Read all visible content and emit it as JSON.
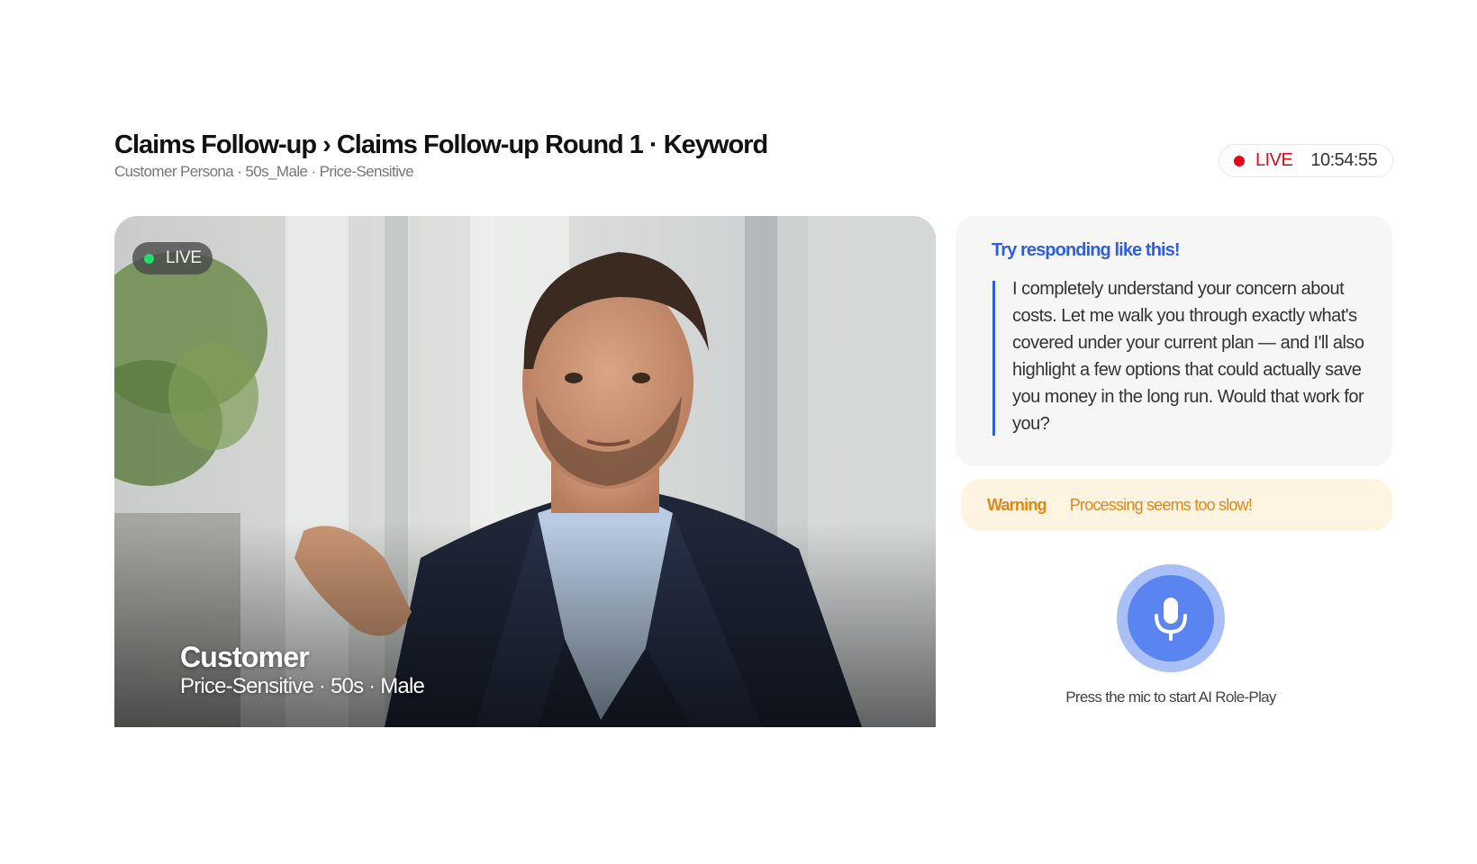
{
  "header": {
    "title": "Claims Follow-up › Claims Follow-up Round 1 · Keyword",
    "subtitle": "Customer Persona · 50s_Male · Price-Sensitive"
  },
  "status": {
    "live_label": "LIVE",
    "time": "10:54:55",
    "live_color": "#e30613"
  },
  "video": {
    "live_badge": "LIVE",
    "role": "Customer",
    "description": "Price-Sensitive · 50s · Male",
    "badge_dot_color": "#22dd6a"
  },
  "suggestion": {
    "title": "Try responding like this!",
    "text": "I completely understand your concern about costs. Let me walk you through exactly what's covered under your current plan — and I'll also highlight a few options that could actually save you money in the long run. Would that work for you?",
    "accent_color": "#2d5fe0"
  },
  "warning": {
    "label": "Warning",
    "message": "Processing seems too slow!",
    "color": "#e08812"
  },
  "mic": {
    "hint": "Press the mic to start AI Role-Play",
    "icon": "microphone-icon"
  }
}
